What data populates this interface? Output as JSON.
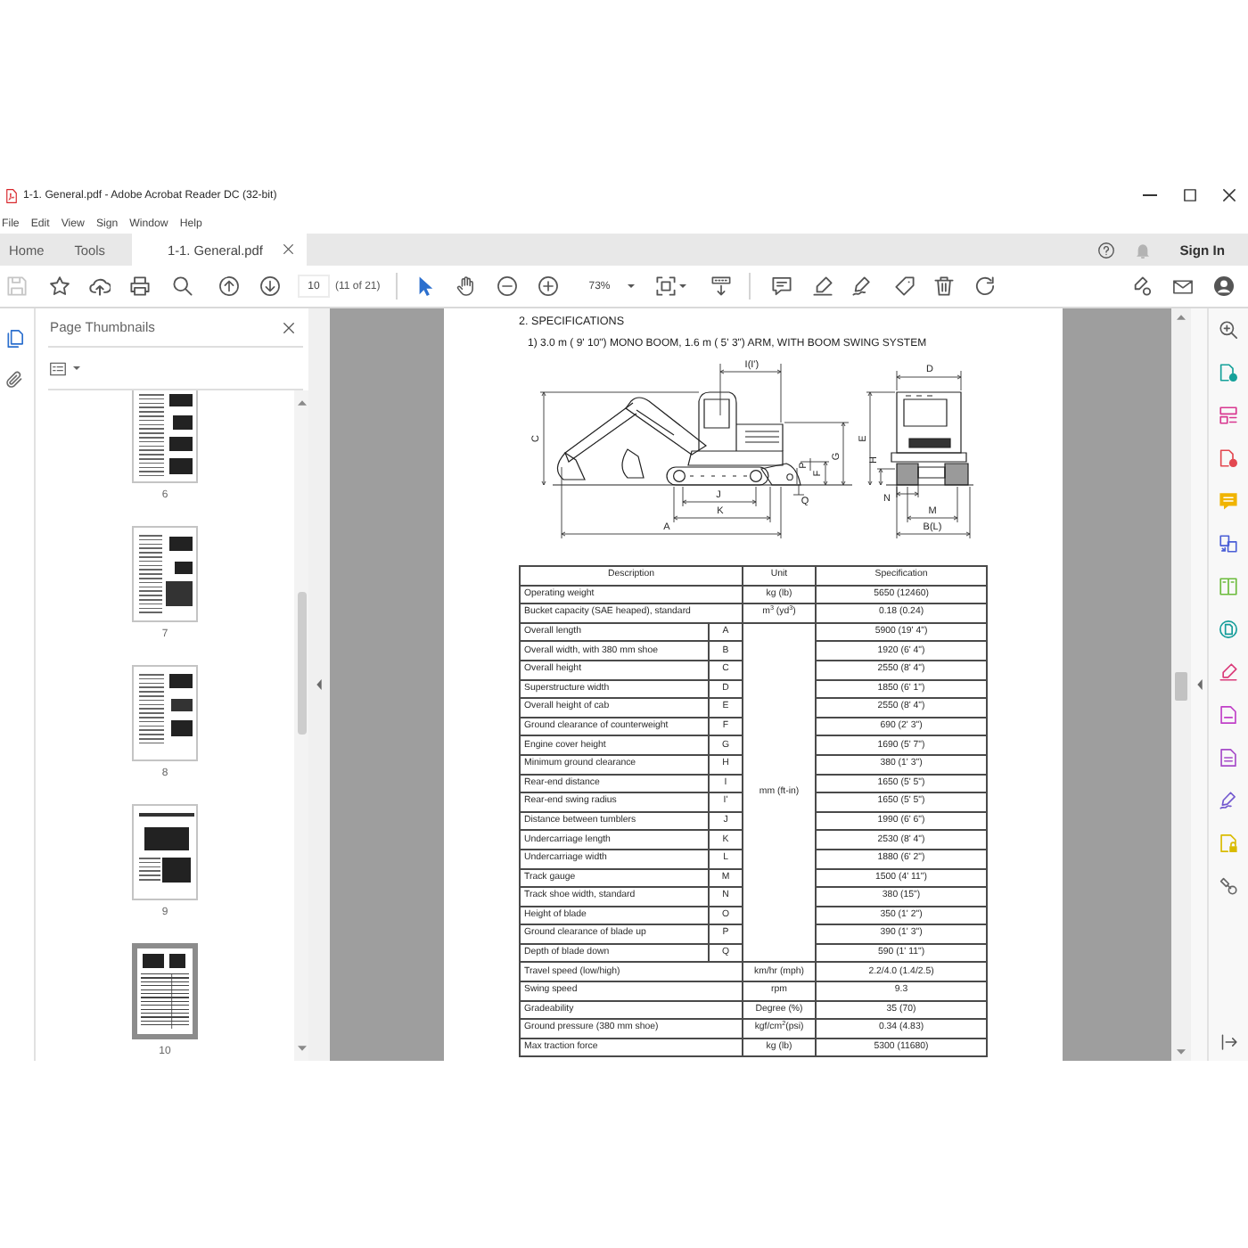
{
  "window": {
    "title": "1-1. General.pdf - Adobe Acrobat Reader DC (32-bit)"
  },
  "menu": [
    "File",
    "Edit",
    "View",
    "Sign",
    "Window",
    "Help"
  ],
  "tabs": [
    {
      "kind": "nav",
      "label": "Home",
      "selected": false
    },
    {
      "kind": "nav",
      "label": "Tools",
      "selected": false
    },
    {
      "kind": "document",
      "label": "1-1. General.pdf",
      "selected": true
    }
  ],
  "account": {
    "sign_in": "Sign In"
  },
  "toolbar": {
    "save": {
      "disabled": true
    },
    "page_number": "10",
    "page_count": "(11 of 21)",
    "tools": [
      {
        "kind": "select",
        "selected": true
      },
      {
        "kind": "hand",
        "selected": false
      }
    ],
    "zoom": "73%"
  },
  "side_nav": [
    {
      "kind": "page_thumbnails",
      "selected": true
    },
    {
      "kind": "attachments",
      "selected": false
    }
  ],
  "thumbnails_panel": {
    "title": "Page Thumbnails",
    "pages": [
      {
        "label": "6",
        "selected": false
      },
      {
        "label": "7",
        "selected": false
      },
      {
        "label": "8",
        "selected": false
      },
      {
        "label": "9",
        "selected": false
      },
      {
        "label": "10",
        "selected": true
      }
    ]
  },
  "document": {
    "heading": "2. SPECIFICATIONS",
    "subheading": "1) 3.0 m ( 9' 10\") MONO BOOM, 1.6 m ( 5' 3\") ARM, WITH BOOM SWING SYSTEM",
    "figure": {
      "side_view_labels": [
        "I(I')",
        "C",
        "G",
        "F",
        "P",
        "O",
        "Q",
        "J",
        "K",
        "A"
      ],
      "front_view_labels": [
        "D",
        "E",
        "H",
        "N",
        "M",
        "B(L)"
      ]
    },
    "table": {
      "columns": [
        "Description",
        "Unit",
        "Specification"
      ],
      "rows": [
        {
          "kind": "single",
          "description": "Operating weight",
          "unit": "kg (lb)",
          "specification": "5650 (12460)"
        },
        {
          "kind": "single",
          "description": "Bucket capacity (SAE heaped), standard",
          "unit": "m$^{3}$ (yd$^{3}$)",
          "specification": "0.18 (0.24)"
        },
        {
          "kind": "group",
          "unit": "mm (ft-in)",
          "rows": [
            {
              "description": "Overall length",
              "symbol": "A",
              "specification": "5900 (19' 4\")"
            },
            {
              "description": "Overall width, with 380 mm shoe",
              "symbol": "B",
              "specification": "1920 (6' 4\")"
            },
            {
              "description": "Overall height",
              "symbol": "C",
              "specification": "2550 (8' 4\")"
            },
            {
              "description": "Superstructure width",
              "symbol": "D",
              "specification": "1850 (6' 1\")"
            },
            {
              "description": "Overall height of cab",
              "symbol": "E",
              "specification": "2550 (8' 4\")"
            },
            {
              "description": "Ground clearance of counterweight",
              "symbol": "F",
              "specification": "690 (2' 3\")"
            },
            {
              "description": "Engine cover height",
              "symbol": "G",
              "specification": "1690 (5' 7\")"
            },
            {
              "description": "Minimum ground clearance",
              "symbol": "H",
              "specification": "380 (1' 3\")"
            },
            {
              "description": "Rear-end distance",
              "symbol": "I",
              "specification": "1650 (5' 5\")"
            },
            {
              "description": "Rear-end swing radius",
              "symbol": "I'",
              "specification": "1650 (5' 5\")"
            },
            {
              "description": "Distance between tumblers",
              "symbol": "J",
              "specification": "1990 (6' 6\")"
            },
            {
              "description": "Undercarriage length",
              "symbol": "K",
              "specification": "2530 (8' 4\")"
            },
            {
              "description": "Undercarriage width",
              "symbol": "L",
              "specification": "1880 (6' 2\")"
            },
            {
              "description": "Track gauge",
              "symbol": "M",
              "specification": "1500 (4' 11\")"
            },
            {
              "description": "Track shoe width, standard",
              "symbol": "N",
              "specification": "380 (15\")"
            },
            {
              "description": "Height of blade",
              "symbol": "O",
              "specification": "350 (1' 2\")"
            },
            {
              "description": "Ground clearance of blade up",
              "symbol": "P",
              "specification": "390 (1' 3\")"
            },
            {
              "description": "Depth of blade down",
              "symbol": "Q",
              "specification": "590 (1' 11\")"
            }
          ]
        },
        {
          "kind": "single",
          "description": "Travel speed (low/high)",
          "unit": "km/hr (mph)",
          "specification": "2.2/4.0 (1.4/2.5)"
        },
        {
          "kind": "single",
          "description": "Swing speed",
          "unit": "rpm",
          "specification": "9.3"
        },
        {
          "kind": "single",
          "description": "Gradeability",
          "unit": "Degree (%)",
          "specification": "35 (70)"
        },
        {
          "kind": "single",
          "description": "Ground pressure (380 mm shoe)",
          "unit": "kgf/cm$^{2}$(psi)",
          "specification": "0.34 (4.83)"
        },
        {
          "kind": "single",
          "description": "Max traction force",
          "unit": "kg (lb)",
          "specification": "5300 (11680)"
        }
      ]
    }
  }
}
